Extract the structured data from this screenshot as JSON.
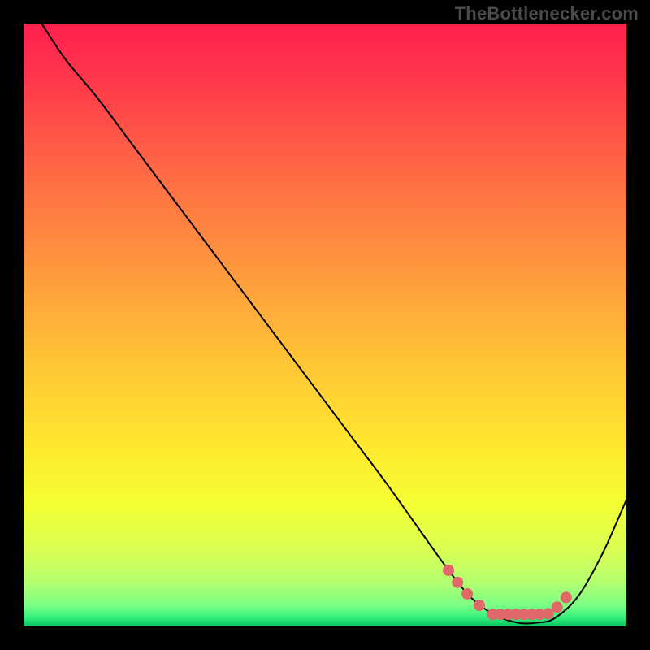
{
  "watermark": "TheBottlenecker.com",
  "gradient": {
    "stops": [
      {
        "offset": 0,
        "color": "#ff1f4e"
      },
      {
        "offset": 0.1,
        "color": "#ff3a4b"
      },
      {
        "offset": 0.25,
        "color": "#ff6b45"
      },
      {
        "offset": 0.4,
        "color": "#ff963e"
      },
      {
        "offset": 0.55,
        "color": "#ffc236"
      },
      {
        "offset": 0.7,
        "color": "#ffe82f"
      },
      {
        "offset": 0.8,
        "color": "#f4ff34"
      },
      {
        "offset": 0.88,
        "color": "#d6ff57"
      },
      {
        "offset": 0.93,
        "color": "#b0ff72"
      },
      {
        "offset": 0.965,
        "color": "#7cff86"
      },
      {
        "offset": 0.985,
        "color": "#36f07e"
      },
      {
        "offset": 1.0,
        "color": "#07c160"
      }
    ]
  },
  "chart_data": {
    "type": "line",
    "title": "",
    "xlabel": "",
    "ylabel": "",
    "xlim": [
      0,
      100
    ],
    "ylim": [
      0,
      100
    ],
    "series": [
      {
        "name": "bottleneck-curve",
        "x": [
          3,
          7,
          12,
          18,
          24,
          30,
          36,
          42,
          48,
          54,
          60,
          65,
          70,
          74,
          78,
          82,
          85,
          88,
          92,
          96,
          100
        ],
        "y": [
          100,
          94,
          88,
          80,
          72,
          64,
          56,
          48,
          40,
          32,
          24,
          17,
          10,
          5,
          2,
          0.6,
          0.6,
          1.3,
          5,
          12,
          21
        ]
      }
    ],
    "highlight": {
      "name": "optimal-range-markers",
      "points": [
        {
          "x": 70.5,
          "y": 9.3
        },
        {
          "x": 72.0,
          "y": 7.3
        },
        {
          "x": 73.6,
          "y": 5.4
        },
        {
          "x": 75.6,
          "y": 3.5
        },
        {
          "x": 77.8,
          "y": 2.0
        },
        {
          "x": 79.1,
          "y": 2.0
        },
        {
          "x": 80.4,
          "y": 2.0
        },
        {
          "x": 81.7,
          "y": 2.0
        },
        {
          "x": 83.0,
          "y": 2.0
        },
        {
          "x": 84.3,
          "y": 2.0
        },
        {
          "x": 85.6,
          "y": 2.0
        },
        {
          "x": 87.0,
          "y": 2.1
        },
        {
          "x": 88.5,
          "y": 3.2
        },
        {
          "x": 90.0,
          "y": 4.8
        }
      ],
      "color": "#e06868",
      "radius_px": 7
    }
  }
}
